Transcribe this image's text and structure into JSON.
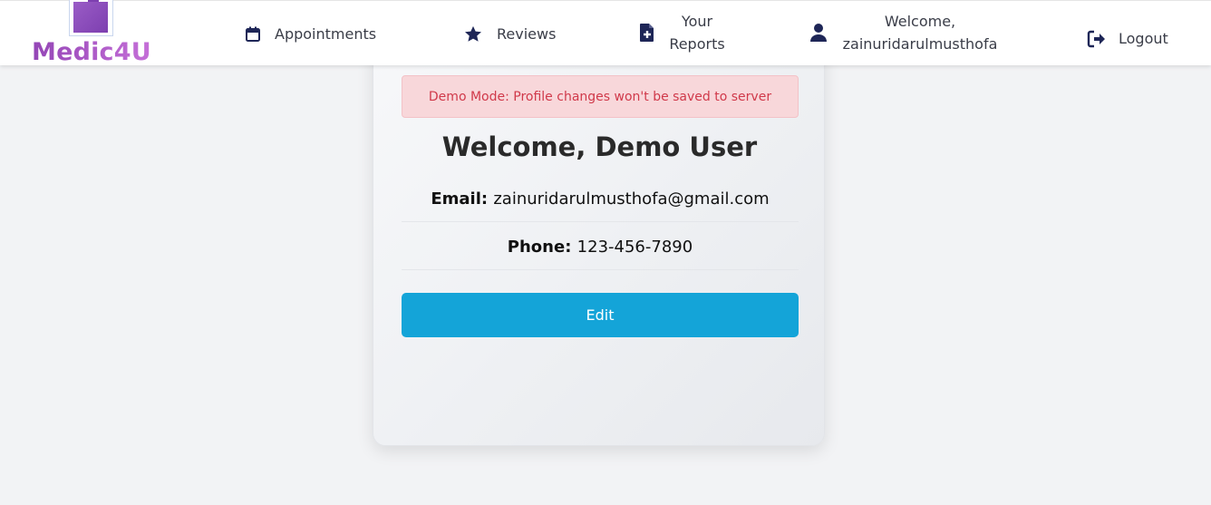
{
  "brand": {
    "name": "Medic4U",
    "logo_icon": "medic4u-logo-image",
    "gradient": [
      "#9446b6",
      "#c56fd8"
    ]
  },
  "nav": {
    "appointments": {
      "label": "Appointments",
      "icon": "calendar-icon"
    },
    "reviews": {
      "label": "Reviews",
      "icon": "star-icon"
    },
    "reports": {
      "label_line1": "Your",
      "label_line2": "Reports",
      "icon": "file-medical-icon"
    },
    "welcome": {
      "label_line1": "Welcome,",
      "label_line2": "zainuridarulmusthofa",
      "icon": "user-icon"
    },
    "logout": {
      "label": "Logout",
      "icon": "sign-out-icon"
    }
  },
  "profile": {
    "alert": "Demo Mode: Profile changes won't be saved to server",
    "title": "Welcome, Demo User",
    "email_label": "Email:",
    "email_value": "zainuridarulmusthofa@gmail.com",
    "phone_label": "Phone:",
    "phone_value": "123-456-7890",
    "edit_label": "Edit"
  },
  "colors": {
    "accent": "#14a4d8",
    "nav_icon": "#1e2657",
    "alert_bg": "#f8d7da",
    "alert_text": "#d0394a",
    "page_bg": "#f2f3f5"
  }
}
